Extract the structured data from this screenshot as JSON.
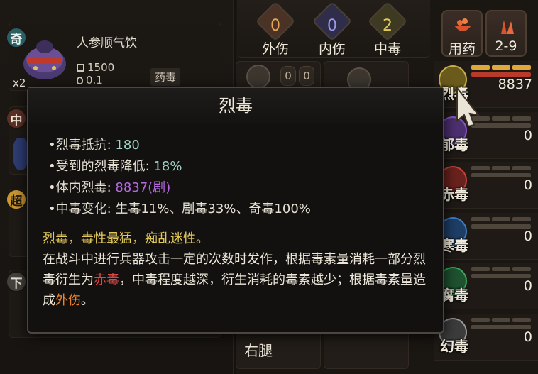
{
  "inventory": {
    "item": {
      "grade": "奇",
      "name": "人参顺气饮",
      "count": "x2",
      "weight": "1500",
      "value": "0.1",
      "tag": "药毒"
    },
    "grades": [
      "中",
      "超",
      "下"
    ]
  },
  "counters": [
    {
      "value": "0",
      "label": "外伤",
      "color": "#e8a45a"
    },
    {
      "value": "0",
      "label": "内伤",
      "color": "#8f8fe8"
    },
    {
      "value": "2",
      "label": "中毒",
      "color": "#d8c35a"
    }
  ],
  "actions": [
    {
      "label": "用药",
      "icon": "medicine-bowl-icon"
    },
    {
      "label": "2-9",
      "icon": "herbs-icon"
    }
  ],
  "body_parts": {
    "pills": [
      "0",
      "0"
    ],
    "leg_label": "右腿"
  },
  "poisons": [
    {
      "name": "烈毒",
      "value": "8837",
      "color": "#c9b04a",
      "fill_fraction": 1.0
    },
    {
      "name": "郁毒",
      "value": "0",
      "color": "#8a55c8",
      "fill_fraction": 0
    },
    {
      "name": "赤毒",
      "value": "0",
      "color": "#c84038",
      "fill_fraction": 0
    },
    {
      "name": "寒毒",
      "value": "0",
      "color": "#3b7ec8",
      "fill_fraction": 0
    },
    {
      "name": "腐毒",
      "value": "0",
      "color": "#3aa85a",
      "fill_fraction": 0
    },
    {
      "name": "幻毒",
      "value": "0",
      "color": "#9a9a9a",
      "fill_fraction": 0
    }
  ],
  "tooltip": {
    "title": "烈毒",
    "stats": [
      {
        "label": "•烈毒抵抗:",
        "value": "180"
      },
      {
        "label": "•受到的烈毒降低:",
        "value": "18%"
      },
      {
        "label": "•体内烈毒:",
        "value": "8837(剧)"
      },
      {
        "label": "•中毒变化:",
        "value": "生毒11%、剧毒33%、奇毒100%"
      }
    ],
    "desc_intro": "烈毒，毒性最猛，痴乱迷性。",
    "desc_part1": "在战斗中进行兵器攻击一定的次数时发作，根据毒素量消耗一部分烈毒衍生为",
    "desc_red": "赤毒",
    "desc_part2": "，中毒程度越深，衍生消耗的毒素越少；根据毒素量造成",
    "desc_orange": "外伤",
    "desc_end": "。"
  }
}
